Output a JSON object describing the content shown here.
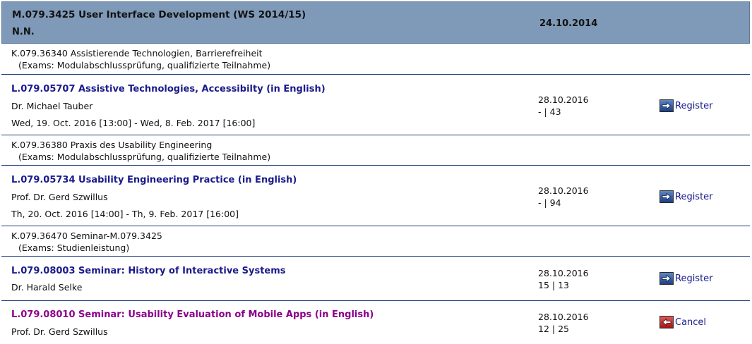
{
  "module": {
    "title": "M.079.3425 User Interface Development (WS 2014/15)",
    "subtitle": "N.N.",
    "date": "24.10.2014"
  },
  "exam1": {
    "name": "K.079.36340 Assistierende Technologien, Barrierefreiheit",
    "exams": "(Exams: Modulabschlussprüfung, qualifizierte Teilnahme)"
  },
  "course1": {
    "title": "L.079.05707 Assistive Technologies, Accessibilty (in English)",
    "lecturer": "Dr. Michael Tauber",
    "schedule": "Wed, 19. Oct. 2016 [13:00] - Wed, 8. Feb. 2017 [16:00]",
    "deadline": "28.10.2016",
    "counts": "- | 43",
    "action": "Register"
  },
  "exam2": {
    "name": "K.079.36380 Praxis des Usability Engineering",
    "exams": "(Exams: Modulabschlussprüfung, qualifizierte Teilnahme)"
  },
  "course2": {
    "title": "L.079.05734 Usability Engineering Practice (in English)",
    "lecturer": "Prof. Dr. Gerd Szwillus",
    "schedule": "Th, 20. Oct. 2016 [14:00] - Th, 9. Feb. 2017 [16:00]",
    "deadline": "28.10.2016",
    "counts": "- | 94",
    "action": "Register"
  },
  "exam3": {
    "name": "K.079.36470 Seminar-M.079.3425",
    "exams": "(Exams: Studienleistung)"
  },
  "course3": {
    "title": "L.079.08003 Seminar: History of Interactive Systems",
    "lecturer": "Dr. Harald Selke",
    "deadline": "28.10.2016",
    "counts": "15 | 13",
    "action": "Register"
  },
  "course4": {
    "title": "L.079.08010 Seminar: Usability Evaluation of Mobile Apps (in English)",
    "lecturer": "Prof. Dr. Gerd Szwillus",
    "deadline": "28.10.2016",
    "counts": "12 | 25",
    "action": "Cancel"
  },
  "colors": {
    "header_bg": "#7f9ab8",
    "link_blue": "#1a1a8c",
    "link_purple": "#8b008b",
    "register_icon": "#1d3f86",
    "cancel_icon": "#a31515"
  },
  "icons": {
    "register": "arrow-right-icon",
    "cancel": "arrow-left-icon"
  }
}
